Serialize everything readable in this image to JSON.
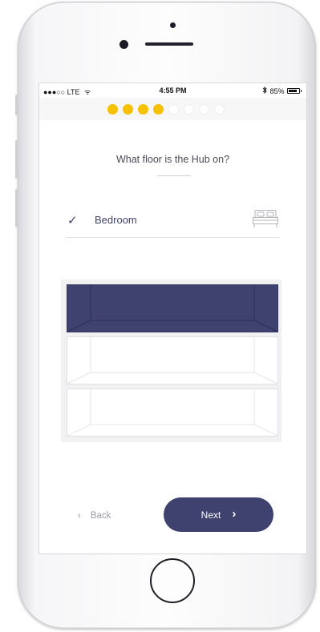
{
  "status_bar": {
    "carrier": "●●●○○ LTE",
    "wifi_icon": "wifi-icon",
    "time": "4:55 PM",
    "bluetooth_icon": "bluetooth-icon",
    "battery_percent": "85%",
    "battery_level": 0.85
  },
  "progress": {
    "total_steps": 8,
    "completed_steps": 4,
    "active_color": "#f6c100",
    "inactive_color": "#ffffff"
  },
  "question": "What floor is the Hub on?",
  "selection": {
    "check_icon": "checkmark-icon",
    "label": "Bedroom",
    "room_icon": "bed-icon"
  },
  "floors": [
    {
      "selected": true
    },
    {
      "selected": false
    },
    {
      "selected": false
    }
  ],
  "colors": {
    "accent": "#3f426e",
    "progress": "#f6c100"
  },
  "footer": {
    "back_label": "Back",
    "next_label": "Next",
    "back_icon": "chevron-left-icon",
    "next_icon": "chevron-right-icon"
  }
}
